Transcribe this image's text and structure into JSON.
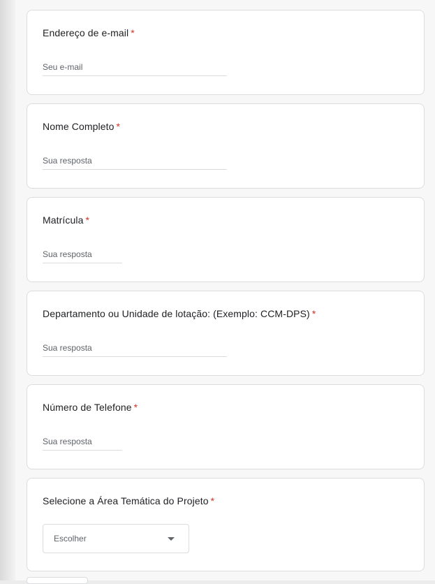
{
  "questions": [
    {
      "title": "Endereço de e-mail",
      "required_mark": "*",
      "placeholder": "Seu e-mail"
    },
    {
      "title": "Nome Completo",
      "required_mark": "*",
      "placeholder": "Sua resposta"
    },
    {
      "title": "Matrícula",
      "required_mark": "*",
      "placeholder": "Sua resposta"
    },
    {
      "title": "Departamento ou Unidade de lotação: (Exemplo: CCM-DPS)",
      "required_mark": "*",
      "placeholder": "Sua resposta"
    },
    {
      "title": "Número de Telefone",
      "required_mark": "*",
      "placeholder": "Sua resposta"
    },
    {
      "title": "Selecione a Área Temática do Projeto",
      "required_mark": "*",
      "select_value": "Escolher"
    }
  ],
  "colors": {
    "required": "#d93025",
    "text": "#202124",
    "hint": "#5f6368",
    "border": "#dadce0"
  },
  "icons": {
    "dropdown": "caret-down-icon"
  }
}
